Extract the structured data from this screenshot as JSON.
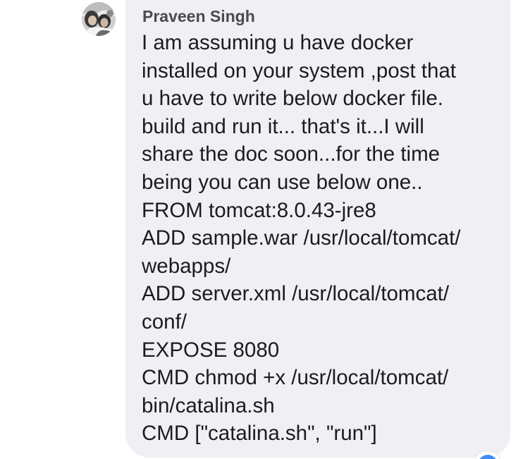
{
  "sender": {
    "name": "Praveen Singh"
  },
  "message": {
    "lines": [
      "I am assuming u have docker",
      "installed on your system ,post that",
      "u have to write below docker file.",
      "build and run it... that's it...I will",
      "share the doc soon...for the time",
      "being you can use below one..",
      "FROM tomcat:8.0.43-jre8",
      "ADD sample.war /usr/local/tomcat/",
      "webapps/",
      "ADD server.xml /usr/local/tomcat/",
      "conf/",
      "EXPOSE 8080",
      "CMD chmod +x /usr/local/tomcat/",
      "bin/catalina.sh",
      "CMD [\"catalina.sh\", \"run\"]"
    ]
  },
  "colors": {
    "bubble": "#efeff4",
    "sender_text": "#4b4b4b",
    "message_text": "#1c1c1e",
    "reaction_accent": "#3f8cf4"
  },
  "icons": {
    "avatar": "profile-photo",
    "reaction": "reaction-badge-icon"
  }
}
